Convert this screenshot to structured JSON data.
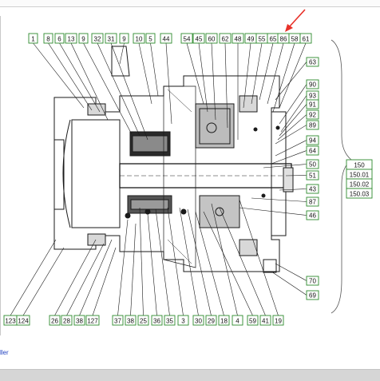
{
  "top_callouts": [
    "1",
    "8",
    "6",
    "13",
    "9",
    "32",
    "31",
    "9",
    "10",
    "5",
    "44",
    "54",
    "45",
    "60",
    "62",
    "48",
    "49",
    "55",
    "65",
    "86",
    "58",
    "61"
  ],
  "right_callouts": [
    "63",
    "90",
    "93",
    "91",
    "92",
    "89",
    "94",
    "64",
    "50",
    "51",
    "43",
    "87",
    "46"
  ],
  "bottom_callouts": [
    "123",
    "124",
    "26",
    "28",
    "38",
    "127",
    "37",
    "38",
    "25",
    "36",
    "35",
    "3",
    "30",
    "29",
    "18",
    "4",
    "59",
    "41",
    "19"
  ],
  "right_extra_callouts": [
    "70",
    "69"
  ],
  "group_list": [
    "150",
    "150.01",
    "150.02",
    "150.03"
  ],
  "footer": {
    "link_text": "ller"
  },
  "colors": {
    "label_border": "#2e8b2e",
    "drawing": "#1a1a1a",
    "arrow": "#e8322a",
    "group_bracket": "#555555"
  }
}
